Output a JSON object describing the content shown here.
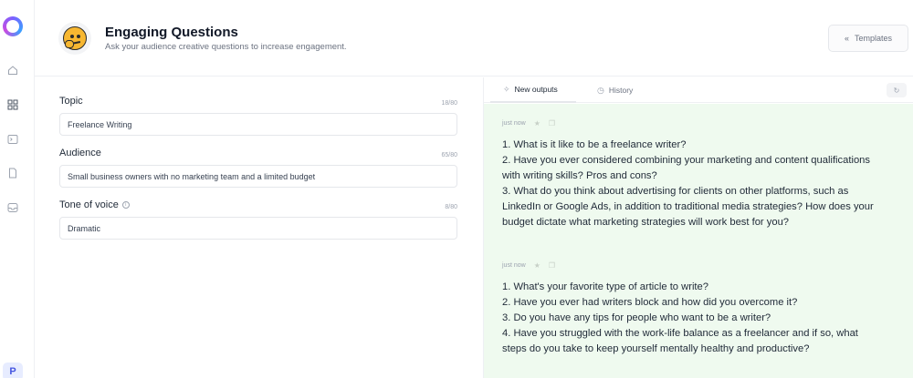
{
  "sidebar": {
    "avatar_letter": "P",
    "icons": [
      "home-icon",
      "grid-icon",
      "terminal-icon",
      "document-icon",
      "inbox-icon"
    ]
  },
  "header": {
    "title": "Engaging Questions",
    "subtitle": "Ask your audience creative questions to increase engagement.",
    "templates_label": "Templates",
    "templates_icon": "«"
  },
  "form": {
    "fields": [
      {
        "label": "Topic",
        "value": "Freelance Writing",
        "counter": "18/80"
      },
      {
        "label": "Audience",
        "value": "Small business owners with no marketing team and a limited budget",
        "counter": "65/80"
      },
      {
        "label": "Tone of voice",
        "value": "Dramatic",
        "counter": "8/80",
        "info_icon": "ⓘ"
      }
    ]
  },
  "outputs_panel": {
    "tabs": [
      {
        "label": "New outputs",
        "icon": "sparkle-icon"
      },
      {
        "label": "History",
        "icon": "clock-icon"
      }
    ],
    "results": [
      {
        "time": "just now",
        "lines": [
          "1. What is it like to be a freelance writer?",
          "2. Have you ever considered combining your marketing and content qualifications",
          "with writing skills? Pros and cons?",
          "3. What do you think about advertising for clients on other platforms, such as",
          "LinkedIn or Google Ads, in addition to traditional media strategies? How does your",
          "budget dictate what marketing strategies will work best for you?"
        ]
      },
      {
        "time": "just now",
        "lines": [
          "1. What's your favorite type of article to write?",
          "2. Have you ever had writers block and how did you overcome it?",
          "3. Do you have any tips for people who want to be a writer?",
          "4. Have you struggled with the work-life balance as a freelancer and if so, what",
          "steps do you take to keep yourself mentally healthy and productive?"
        ]
      }
    ]
  },
  "colors": {
    "output_background": "#effaef",
    "accent": "#4656e0"
  }
}
